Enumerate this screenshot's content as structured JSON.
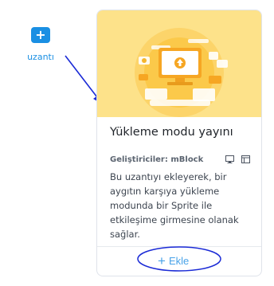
{
  "side_extension": {
    "icon": "plus-icon",
    "label": "uzantı"
  },
  "card": {
    "title": "Yükleme modu yayını",
    "developer": "Geliştiriciler: mBlock",
    "platform_icons": [
      "desktop-icon",
      "browser-window-icon"
    ],
    "description_lines": [
      "Bu uzantıyı ekleyerek, bir",
      "aygıtın karşıya yükleme",
      "modunda bir Sprite ile",
      "etkileşime girmesine olanak",
      "sağlar."
    ],
    "add_button": {
      "icon": "plus-icon",
      "label": "Ekle"
    }
  },
  "colors": {
    "accent": "#1a8fe3",
    "banner": "#fde28a",
    "annotation": "#1a2ad6"
  }
}
